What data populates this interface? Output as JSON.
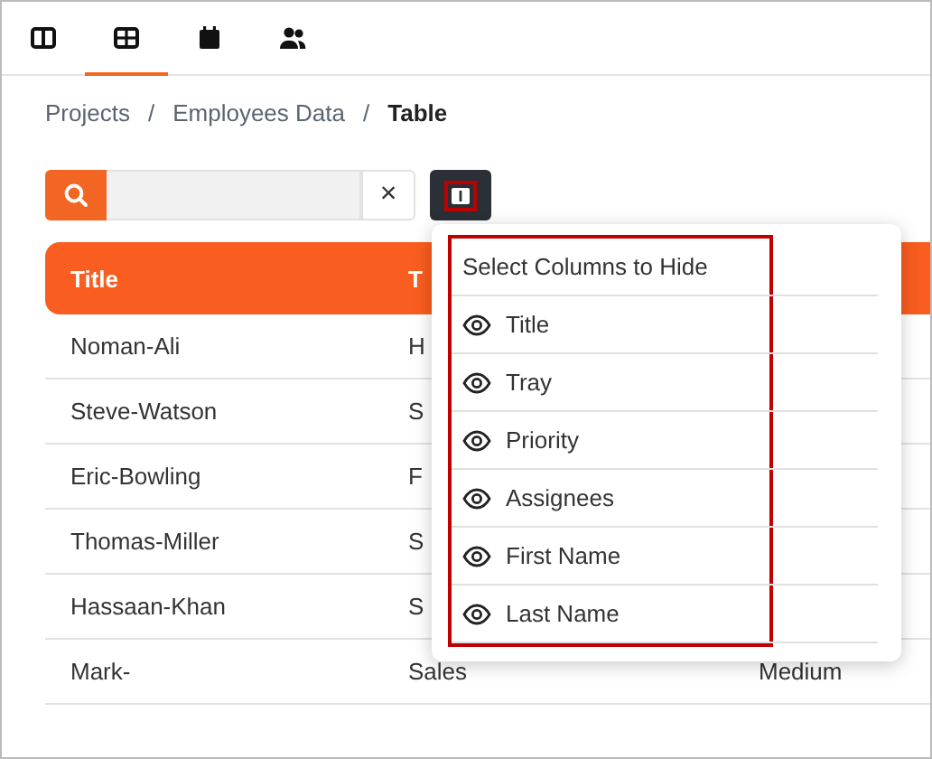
{
  "tabs": [
    {
      "selected": false
    },
    {
      "selected": true
    },
    {
      "selected": false
    },
    {
      "selected": false
    }
  ],
  "breadcrumb": [
    "Projects",
    "Employees Data",
    "Table"
  ],
  "breadcrumb_separator": "/",
  "search": {
    "clear": "×"
  },
  "table": {
    "columns": [
      "Title",
      "T"
    ],
    "rows": [
      {
        "cells": [
          "Noman-Ali",
          "H"
        ]
      },
      {
        "cells": [
          "Steve-Watson",
          "S"
        ]
      },
      {
        "cells": [
          "Eric-Bowling",
          "F"
        ]
      },
      {
        "cells": [
          "Thomas-Miller",
          "S"
        ]
      },
      {
        "cells": [
          "Hassaan-Khan",
          "S"
        ]
      },
      {
        "cells": [
          "Mark-",
          "Sales",
          "Medium"
        ]
      }
    ]
  },
  "column_menu": {
    "title": "Select Columns to Hide",
    "items": [
      {
        "label": "Title",
        "visible": true
      },
      {
        "label": "Tray",
        "visible": true
      },
      {
        "label": "Priority",
        "visible": true
      },
      {
        "label": "Assignees",
        "visible": true
      },
      {
        "label": "First Name",
        "visible": true
      },
      {
        "label": "Last Name",
        "visible": true
      }
    ]
  }
}
